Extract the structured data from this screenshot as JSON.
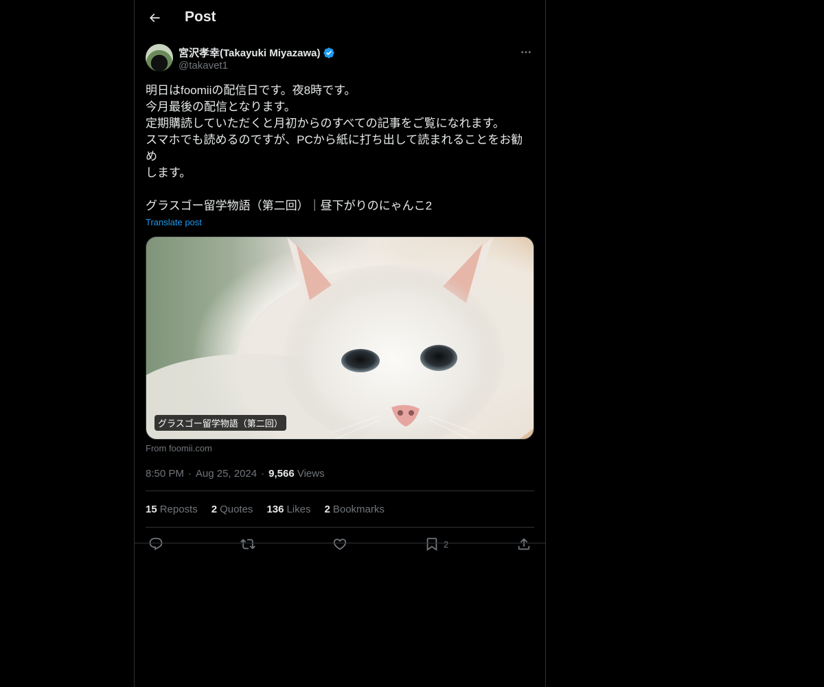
{
  "header": {
    "title": "Post"
  },
  "author": {
    "display_name": "宮沢孝幸(Takayuki Miyazawa)",
    "handle": "@takavet1",
    "verified": true
  },
  "post": {
    "lines": [
      "明日はfoomiiの配信日です。夜8時です。",
      "今月最後の配信となります。",
      "定期購読していただくと月初からのすべての記事をご覧になれます。",
      "スマホでも読めるのですが、PCから紙に打ち出して読まれることをお勧め",
      "します。",
      "",
      "グラスゴー留学物語（第二回）｜昼下がりのにゃんこ2"
    ],
    "translate_label": "Translate post"
  },
  "card": {
    "label": "グラスゴー留学物語（第二回）",
    "source": "From foomii.com",
    "image_icon": "white-cat-photo"
  },
  "meta": {
    "time": "8:50 PM",
    "date": "Aug 25, 2024",
    "views_count": "9,566",
    "views_label": "Views"
  },
  "stats": [
    {
      "count": "15",
      "label": "Reposts"
    },
    {
      "count": "2",
      "label": "Quotes"
    },
    {
      "count": "136",
      "label": "Likes"
    },
    {
      "count": "2",
      "label": "Bookmarks"
    }
  ],
  "actions": {
    "bookmark_count": "2"
  },
  "colors": {
    "background": "#000000",
    "text": "#e7e9ea",
    "muted": "#71767b",
    "accent": "#1d9bf0",
    "border": "#2f3336"
  }
}
